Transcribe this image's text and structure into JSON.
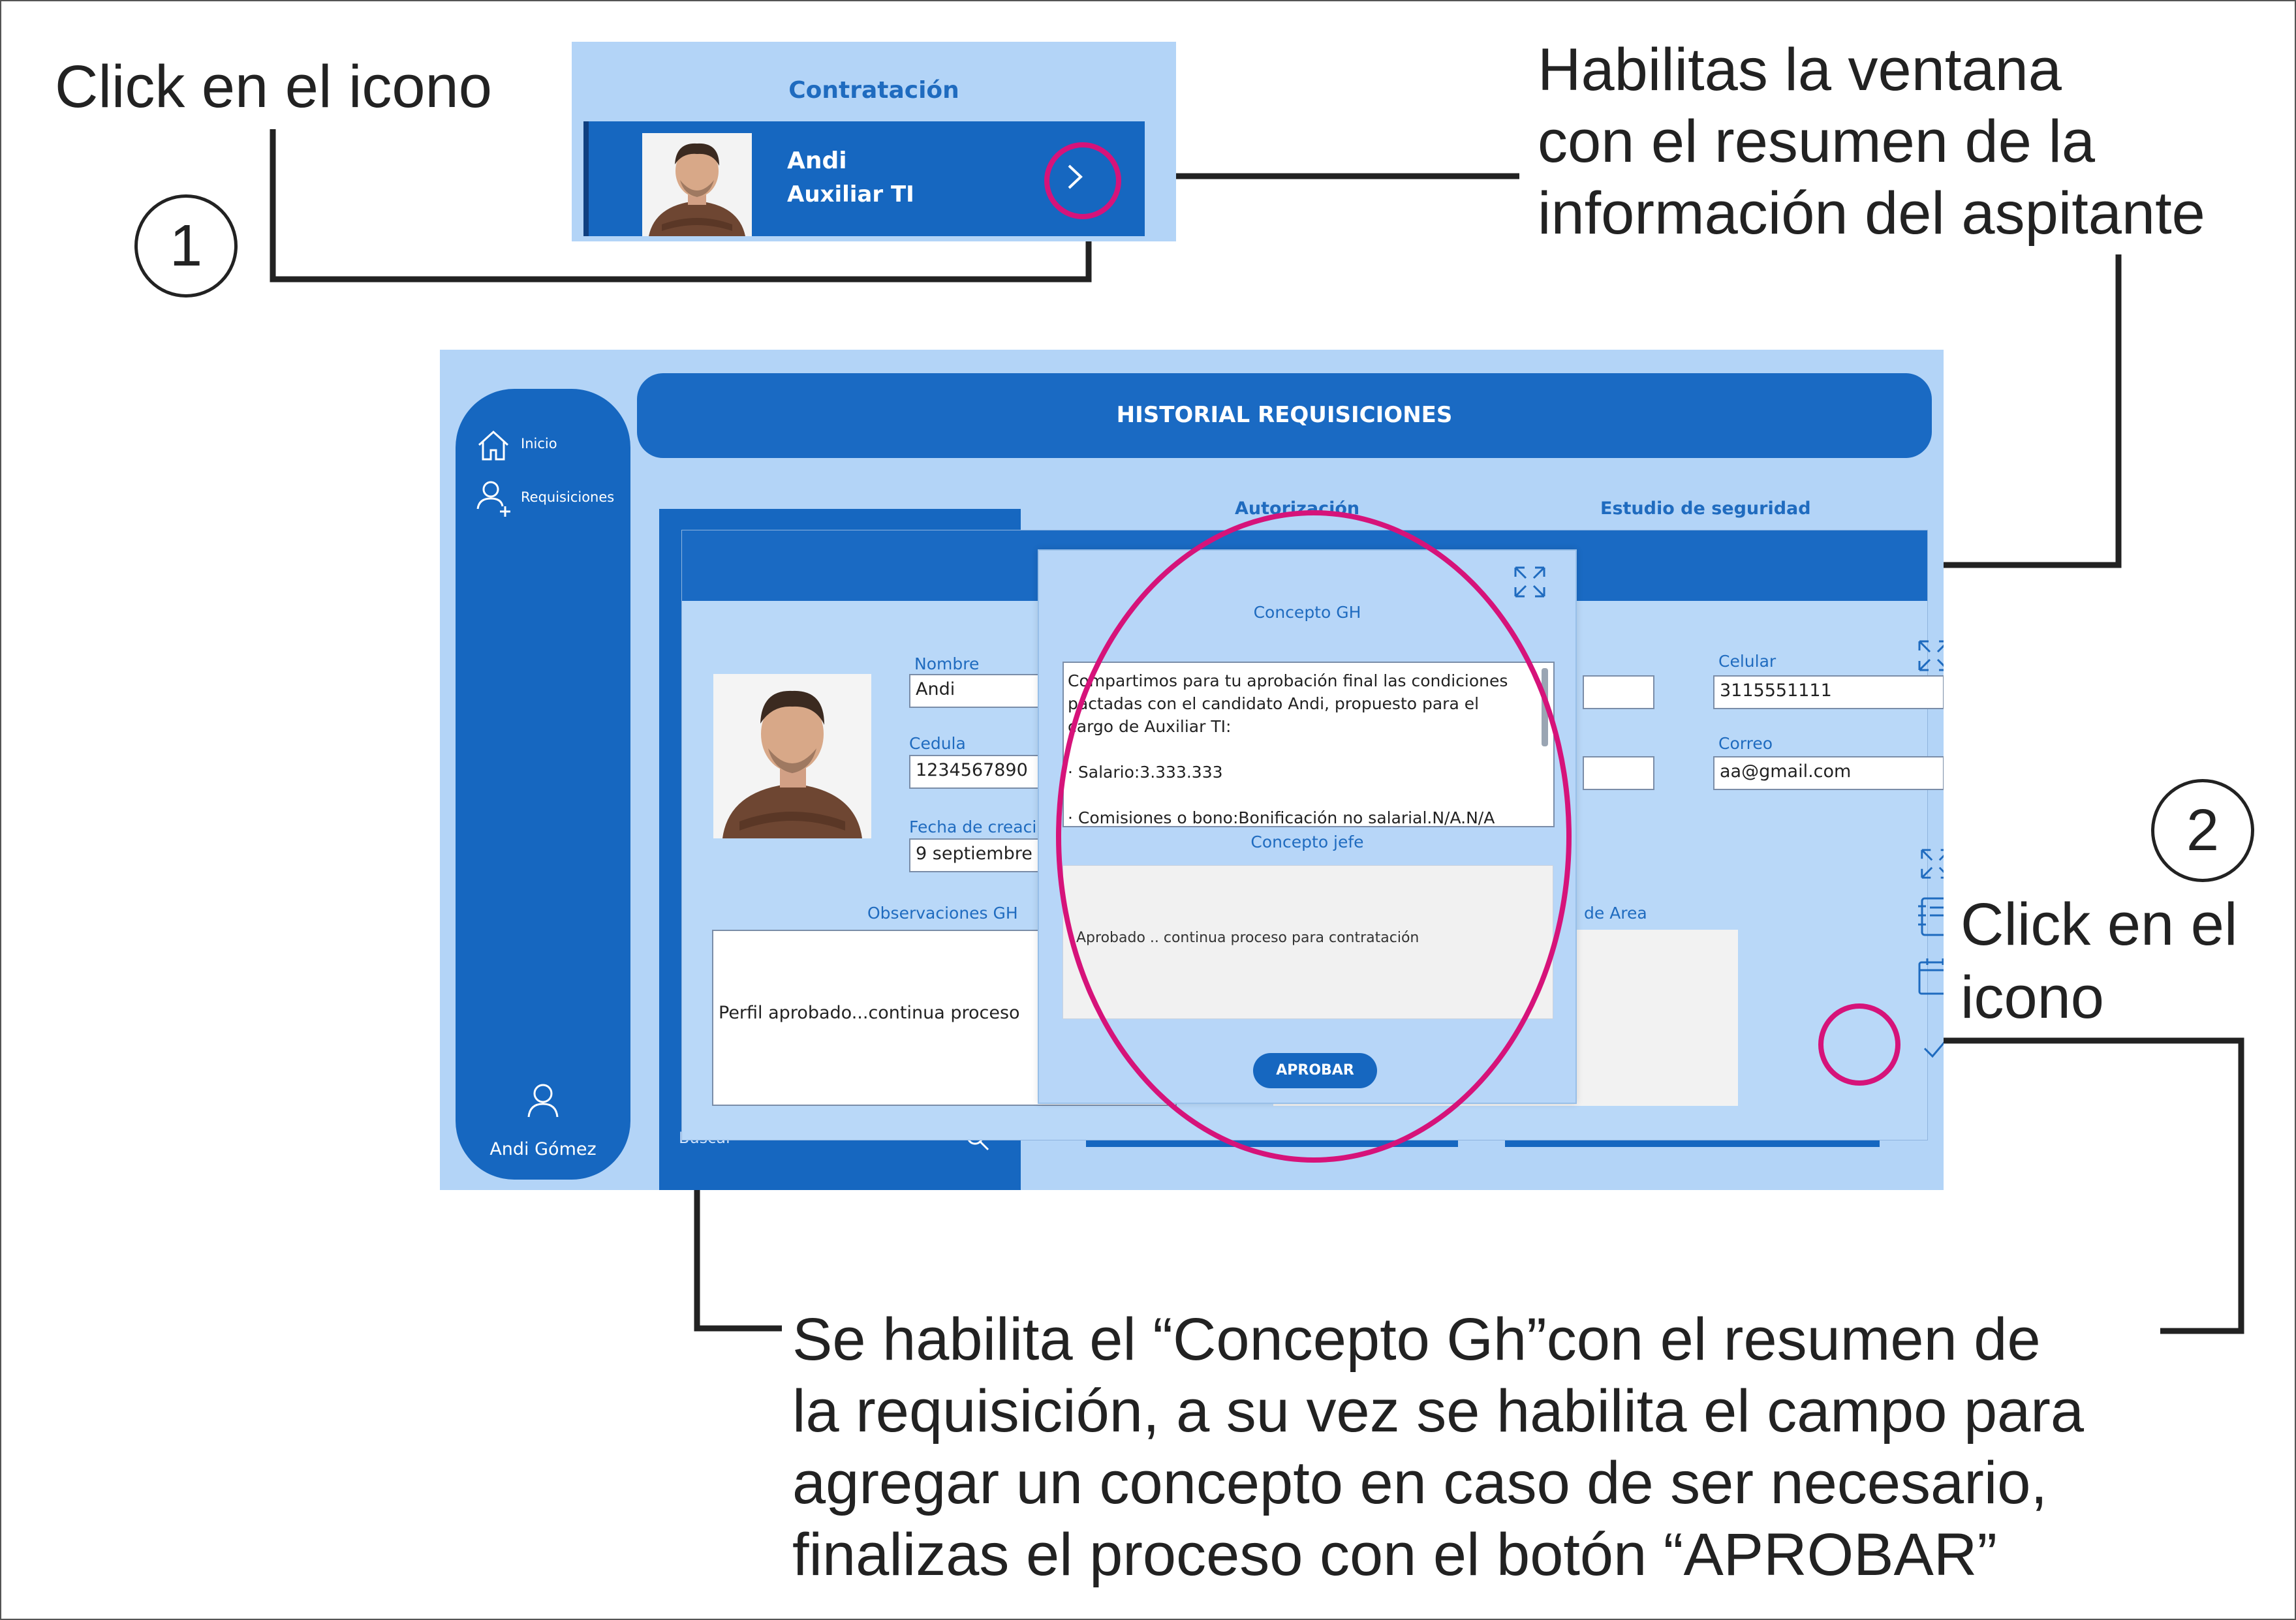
{
  "callouts": {
    "step1_text": "Click en el icono",
    "step1_number": "1",
    "top_right_line1": "Habilitas la ventana",
    "top_right_line2": "con el resumen de la",
    "top_right_line3": "información del aspitante",
    "step2_number": "2",
    "step2_line1": "Click en el",
    "step2_line2": "icono",
    "bottom_line1": "Se habilita el “Concepto Gh”con el resumen de",
    "bottom_line2": "la requisición, a su vez se habilita el campo para",
    "bottom_line3": "agregar un concepto en caso de ser necesario,",
    "bottom_line4": "finalizas el proceso con el botón “APROBAR”"
  },
  "contratacion_card": {
    "header": "Contratación",
    "name": "Andi",
    "role": "Auxiliar TI",
    "arrow_icon": "chevron-right-icon"
  },
  "app": {
    "title": "HISTORIAL REQUISICIONES",
    "sidebar": {
      "items": [
        {
          "label": "Inicio",
          "icon": "home-icon"
        },
        {
          "label": "Requisiciones",
          "icon": "user-add-icon"
        }
      ],
      "user_name": "Andi Gómez",
      "user_icon": "user-icon"
    },
    "tabs": {
      "autorizacion": "Autorización",
      "estudio": "Estudio de seguridad"
    },
    "candidate": {
      "nombre_label": "Nombre",
      "nombre_value": "Andi",
      "cedula_label": "Cedula",
      "cedula_value": "1234567890",
      "fecha_label": "Fecha de creaci",
      "fecha_value": "9 septiembre",
      "celular_label": "Celular",
      "celular_value": "3115551111",
      "correo_label": "Correo",
      "correo_value": "aa@gmail.com"
    },
    "observaciones": {
      "label": "Observaciones GH",
      "value": "Perfil aprobado...continua proceso",
      "area_label": "de Area"
    },
    "search_text": "Buscar"
  },
  "popup": {
    "title": "Concepto GH",
    "concepto_lines": [
      "Compartimos para tu aprobación final las condiciones",
      "pactadas con el candidato Andi, propuesto para el",
      "cargo de Auxiliar TI:",
      "",
      "· Salario:3.333.333",
      "",
      "· Comisiones o bono:Bonificación no salarial.N/A.N/A"
    ],
    "jefe_label": "Concepto jefe",
    "jefe_value": "Aprobado .. continua proceso para contratación",
    "approve_button": "APROBAR"
  },
  "colors": {
    "app_bg": "#b3d4f7",
    "dark_blue": "#1667c0",
    "header_blue": "#1a6ac3",
    "highlight_magenta": "#d6137a",
    "label_blue": "#1f6bbf"
  }
}
